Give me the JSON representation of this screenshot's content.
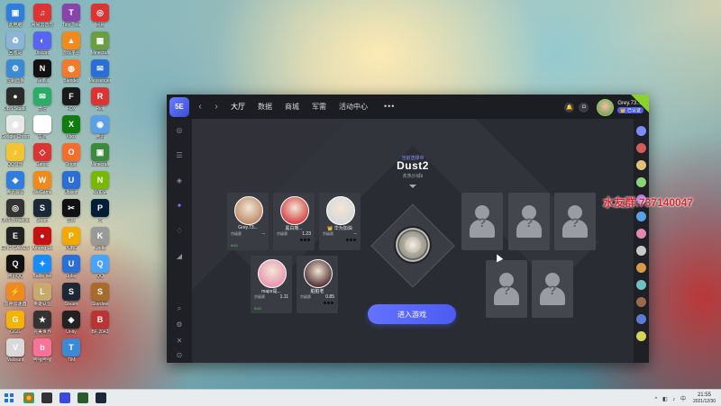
{
  "desktop": {
    "icons": [
      {
        "label": "此电脑",
        "color": "#2f7de1",
        "glyph": "▣"
      },
      {
        "label": "回收站",
        "color": "#8ab4d8",
        "glyph": "♻"
      },
      {
        "label": "控制面板",
        "color": "#3a8ad6",
        "glyph": "⚙"
      },
      {
        "label": "OBS Studio",
        "color": "#2b2b2b",
        "glyph": "●"
      },
      {
        "label": "Google Chrome",
        "color": "#e8e8e8",
        "glyph": "◉"
      },
      {
        "label": "QQ音乐",
        "color": "#f4c430",
        "glyph": "♪"
      },
      {
        "label": "腾讯会议",
        "color": "#2f7de1",
        "glyph": "◆"
      },
      {
        "label": "OBS Broadcast",
        "color": "#333",
        "glyph": "◎"
      },
      {
        "label": "EPIC GAMES Launcher",
        "color": "#222",
        "glyph": "E"
      },
      {
        "label": "腾讯QQ",
        "color": "#111",
        "glyph": "Q"
      },
      {
        "label": "雷神加速器",
        "color": "#f08a1c",
        "glyph": "⚡"
      },
      {
        "label": "GGG",
        "color": "#f2b400",
        "glyph": "G"
      },
      {
        "label": "Valorant",
        "color": "#d9d9d9",
        "glyph": "V"
      },
      {
        "label": "网易云音乐",
        "color": "#d33",
        "glyph": "♫"
      },
      {
        "label": "Discord",
        "color": "#5865f2",
        "glyph": "◐"
      },
      {
        "label": "Netflix",
        "color": "#111",
        "glyph": "N"
      },
      {
        "label": "微信",
        "color": "#2aae67",
        "glyph": "✉"
      },
      {
        "label": "文档",
        "color": "#fff",
        "glyph": "≡"
      },
      {
        "label": "Gateio",
        "color": "#d33",
        "glyph": "◇"
      },
      {
        "label": "WeGame",
        "color": "#f08a1c",
        "glyph": "W"
      },
      {
        "label": "Steam",
        "color": "#1b2838",
        "glyph": "S"
      },
      {
        "label": "Among Us",
        "color": "#c51111",
        "glyph": "●"
      },
      {
        "label": "Battle.net",
        "color": "#148eff",
        "glyph": "✦"
      },
      {
        "label": "英雄联盟",
        "color": "#c8aa6e",
        "glyph": "L"
      },
      {
        "label": "完美世界",
        "color": "#333",
        "glyph": "★"
      },
      {
        "label": "哔哩哔哩",
        "color": "#fb7299",
        "glyph": "b"
      },
      {
        "label": "Tiny Tina",
        "color": "#8844aa",
        "glyph": "T"
      },
      {
        "label": "游戏平台",
        "color": "#f08a1c",
        "glyph": "▲"
      },
      {
        "label": "Blender",
        "color": "#f5792a",
        "glyph": "◍"
      },
      {
        "label": "FOX",
        "color": "#1a1a1a",
        "glyph": "F"
      },
      {
        "label": "Xbox",
        "color": "#107c10",
        "glyph": "X"
      },
      {
        "label": "Origin",
        "color": "#f56c2d",
        "glyph": "O"
      },
      {
        "label": "Ubisoft",
        "color": "#2b6fd6",
        "glyph": "U"
      },
      {
        "label": "剪映",
        "color": "#111",
        "glyph": "✂"
      },
      {
        "label": "PUBG",
        "color": "#f2a900",
        "glyph": "P"
      },
      {
        "label": "Uplay",
        "color": "#2b6fd6",
        "glyph": "U"
      },
      {
        "label": "Steam",
        "color": "#1b2838",
        "glyph": "S"
      },
      {
        "label": "Unity",
        "color": "#222",
        "glyph": "◈"
      },
      {
        "label": "TIM",
        "color": "#3a8ad6",
        "glyph": "T"
      },
      {
        "label": "网易",
        "color": "#d33",
        "glyph": "◎"
      },
      {
        "label": "Minecraft",
        "color": "#6a9e3f",
        "glyph": "▦"
      },
      {
        "label": "Messenger",
        "color": "#2b6fd6",
        "glyph": "✉"
      },
      {
        "label": "Riot",
        "color": "#d33",
        "glyph": "R"
      },
      {
        "label": "腾讯",
        "color": "#5aa0e8",
        "glyph": "◉"
      },
      {
        "label": "Minecraft",
        "color": "#3c8b3c",
        "glyph": "▣"
      },
      {
        "label": "NVIDIA",
        "color": "#76b900",
        "glyph": "N"
      },
      {
        "label": "PS",
        "color": "#001e36",
        "glyph": "P"
      },
      {
        "label": "Kindle",
        "color": "#999",
        "glyph": "K"
      },
      {
        "label": "QQ",
        "color": "#4aa3ff",
        "glyph": "Q"
      },
      {
        "label": "Stardew",
        "color": "#a96b2a",
        "glyph": "S"
      },
      {
        "label": "BF 2042",
        "color": "#b33",
        "glyph": "B"
      }
    ]
  },
  "app": {
    "logo_text": "5E",
    "nav": [
      "大厅",
      "数据",
      "商城",
      "军需",
      "活动中心"
    ],
    "nav_more": "•••",
    "back_arrow": "‹",
    "forward_arrow": "›",
    "bell_icon": "🔔",
    "gift_icon": "◘",
    "user_name": "Grey.73...",
    "user_badge": "👑 已认证",
    "rail_icons": [
      "◎",
      "☰",
      "◈",
      "✦",
      "♢",
      "◢"
    ],
    "rail_bottom_icons": [
      "⌕",
      "⚙",
      "✕",
      "⊙"
    ]
  },
  "lobby": {
    "map_hint": "当前选择中",
    "map_name": "Dust2",
    "map_sub": "炙热沙城Ⅱ",
    "join_button": "进入游戏",
    "team": [
      {
        "name": "Grey.73...",
        "rank": "京级赛",
        "rating": "--",
        "count": "0/10",
        "avatar_color": "#c08f6e"
      },
      {
        "name": "黑白熊...",
        "rank": "京级赛",
        "rating": "1.23",
        "count": "",
        "avatar_color": "#d64a4a"
      },
      {
        "name": "👑 华为加油",
        "rank": "京级赛",
        "rating": "--",
        "count": "",
        "avatar_color": "#d8d8d8"
      },
      {
        "name": "major是...",
        "rank": "京级赛",
        "rating": "1.11",
        "count": "0/10",
        "avatar_color": "#e89ab0"
      },
      {
        "name": "脏脏老",
        "rank": "京级赛",
        "rating": "0.85",
        "count": "",
        "avatar_color": "#5b3a3a"
      }
    ],
    "empty_slot_mark": "?"
  },
  "watermark": "水友群:737140047",
  "taskbar": {
    "clock_time": "21:55",
    "clock_date": "2021/12/30",
    "tray_icons": "^ ◧ ♪ 中"
  },
  "colors": {
    "accent": "#5c6cf5",
    "watermark": "#e0202c",
    "online": "#69d26b"
  }
}
